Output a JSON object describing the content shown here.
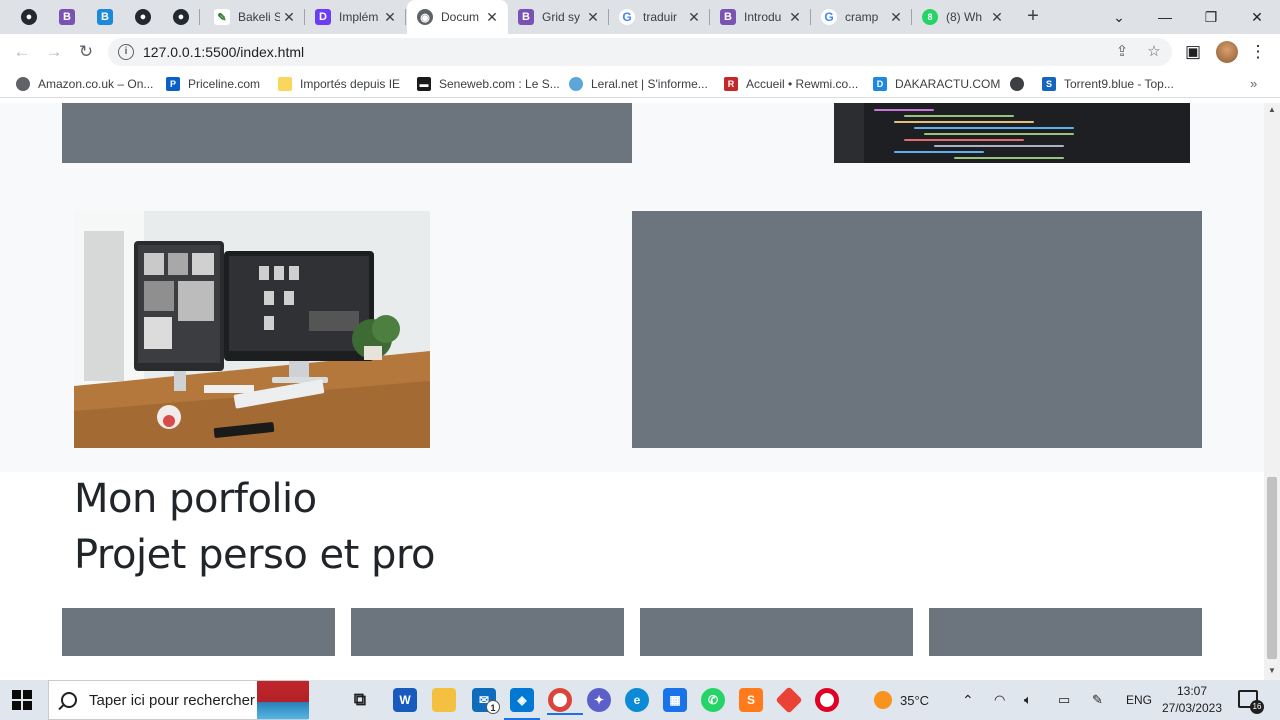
{
  "browser": {
    "tabs": [
      {
        "kind": "pinned",
        "favicon": "github-icon"
      },
      {
        "kind": "pinned",
        "favicon": "bootstrap-icon"
      },
      {
        "kind": "pinned",
        "favicon": "bootstrap-blue-icon"
      },
      {
        "kind": "pinned",
        "favicon": "github-icon"
      },
      {
        "kind": "pinned",
        "favicon": "github-icon"
      },
      {
        "kind": "tab",
        "favicon": "bakeli-icon",
        "title": "Bakeli S"
      },
      {
        "kind": "tab",
        "favicon": "dart-icon",
        "title": "Implém"
      },
      {
        "kind": "tab",
        "favicon": "globe-icon",
        "title": "Docum",
        "active": true
      },
      {
        "kind": "tab",
        "favicon": "bootstrap-icon",
        "title": "Grid sy"
      },
      {
        "kind": "tab",
        "favicon": "google-icon",
        "title": "traduir"
      },
      {
        "kind": "tab",
        "favicon": "bootstrap-icon",
        "title": "Introdu"
      },
      {
        "kind": "tab",
        "favicon": "google-icon",
        "title": "cramp"
      },
      {
        "kind": "tab",
        "favicon": "whatsapp-icon",
        "title": "(8) Wh"
      }
    ],
    "whatsapp_badge": "8",
    "address_bar": {
      "url": "127.0.0.1:5500/index.html"
    },
    "bookmarks": [
      {
        "label": "Amazon.co.uk – On...",
        "icon": "globe-icon"
      },
      {
        "label": "Priceline.com",
        "icon": "priceline-icon"
      },
      {
        "label": "Importés depuis IE",
        "icon": "folder-icon"
      },
      {
        "label": "Seneweb.com : Le S...",
        "icon": "seneweb-icon"
      },
      {
        "label": "Leral.net | S'informe...",
        "icon": "leral-icon"
      },
      {
        "label": "Accueil • Rewmi.co...",
        "icon": "rewmi-icon"
      },
      {
        "label": "DAKARACTU.COM",
        "icon": "dakaractu-icon"
      },
      {
        "label": "",
        "icon": "globe-icon"
      },
      {
        "label": "Torrent9.blue - Top...",
        "icon": "torrent-icon"
      }
    ]
  },
  "page": {
    "heading_line1": "Mon porfolio",
    "heading_line2": "Projet perso et pro",
    "placeholder_color": "#6c757d",
    "band_color": "#f8f9fa"
  },
  "taskbar": {
    "search_placeholder": "Taper ici pour rechercher",
    "mail_badge": "1",
    "weather": "35°C",
    "language": "ENG",
    "time": "13:07",
    "date": "27/03/2023",
    "notifications": "16"
  }
}
